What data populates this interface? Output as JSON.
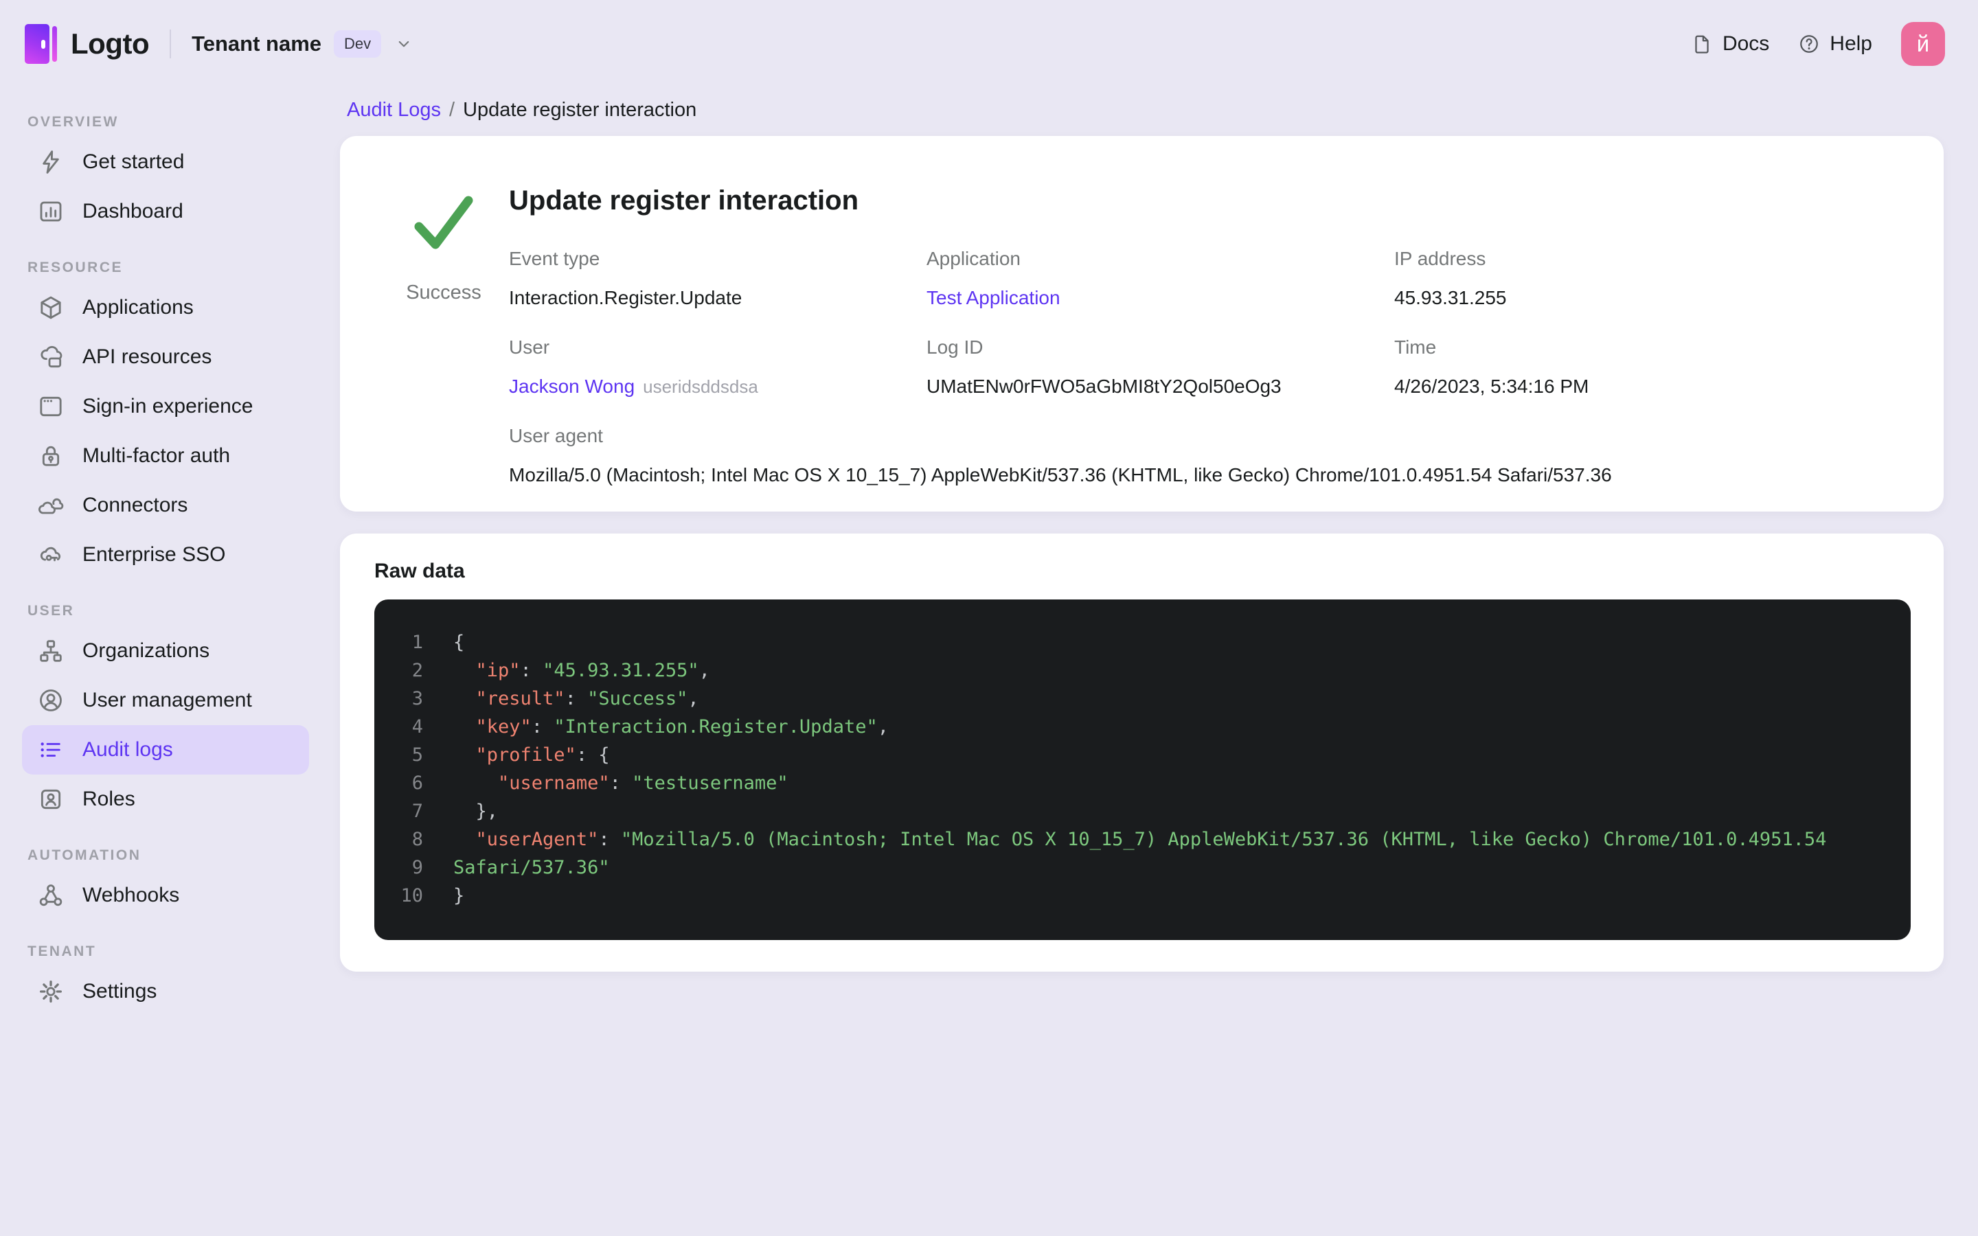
{
  "topbar": {
    "logo_text": "Logto",
    "tenant_name": "Tenant name",
    "tenant_badge": "Dev",
    "docs_label": "Docs",
    "help_label": "Help",
    "avatar_initial": "й"
  },
  "sidebar": {
    "sections": [
      {
        "label": "OVERVIEW",
        "items": [
          {
            "slug": "get-started",
            "label": "Get started",
            "icon": "lightning-icon",
            "active": false
          },
          {
            "slug": "dashboard",
            "label": "Dashboard",
            "icon": "dashboard-icon",
            "active": false
          }
        ]
      },
      {
        "label": "RESOURCE",
        "items": [
          {
            "slug": "applications",
            "label": "Applications",
            "icon": "cube-icon",
            "active": false
          },
          {
            "slug": "api-resources",
            "label": "API resources",
            "icon": "cloud-box-icon",
            "active": false
          },
          {
            "slug": "sign-in-experience",
            "label": "Sign-in experience",
            "icon": "browser-icon",
            "active": false
          },
          {
            "slug": "multi-factor-auth",
            "label": "Multi-factor auth",
            "icon": "lock-icon",
            "active": false
          },
          {
            "slug": "connectors",
            "label": "Connectors",
            "icon": "clouds-icon",
            "active": false
          },
          {
            "slug": "enterprise-sso",
            "label": "Enterprise SSO",
            "icon": "cloud-key-icon",
            "active": false
          }
        ]
      },
      {
        "label": "USER",
        "items": [
          {
            "slug": "organizations",
            "label": "Organizations",
            "icon": "org-chart-icon",
            "active": false
          },
          {
            "slug": "user-management",
            "label": "User management",
            "icon": "user-circle-icon",
            "active": false
          },
          {
            "slug": "audit-logs",
            "label": "Audit logs",
            "icon": "list-icon",
            "active": true
          },
          {
            "slug": "roles",
            "label": "Roles",
            "icon": "id-card-icon",
            "active": false
          }
        ]
      },
      {
        "label": "AUTOMATION",
        "items": [
          {
            "slug": "webhooks",
            "label": "Webhooks",
            "icon": "webhook-icon",
            "active": false
          }
        ]
      },
      {
        "label": "TENANT",
        "items": [
          {
            "slug": "settings",
            "label": "Settings",
            "icon": "gear-icon",
            "active": false
          }
        ]
      }
    ]
  },
  "breadcrumb": {
    "parent": "Audit Logs",
    "separator": "/",
    "current": "Update register interaction"
  },
  "event_card": {
    "status": "Success",
    "title": "Update register interaction",
    "fields": [
      {
        "slug": "event-type",
        "label": "Event type",
        "value": "Interaction.Register.Update",
        "type": "text"
      },
      {
        "slug": "application",
        "label": "Application",
        "value": "Test Application",
        "type": "link"
      },
      {
        "slug": "ip-address",
        "label": "IP address",
        "value": "45.93.31.255",
        "type": "text"
      },
      {
        "slug": "user",
        "label": "User",
        "value": "Jackson Wong",
        "suffix": "useridsddsdsa",
        "type": "link"
      },
      {
        "slug": "log-id",
        "label": "Log ID",
        "value": "UMatENw0rFWO5aGbMI8tY2Qol50eOg3",
        "type": "text"
      },
      {
        "slug": "time",
        "label": "Time",
        "value": "4/26/2023, 5:34:16 PM",
        "type": "text"
      }
    ],
    "user_agent": {
      "label": "User agent",
      "value": "Mozilla/5.0 (Macintosh; Intel Mac OS X 10_15_7) AppleWebKit/537.36 (KHTML, like Gecko) Chrome/101.0.4951.54 Safari/537.36"
    }
  },
  "raw_data_card": {
    "title": "Raw data",
    "code_lines": [
      {
        "number": "1",
        "tokens": [
          {
            "t": "{",
            "c": "punct"
          }
        ]
      },
      {
        "number": "2",
        "tokens": [
          {
            "t": "  ",
            "c": "punct"
          },
          {
            "t": "\"ip\"",
            "c": "key"
          },
          {
            "t": ": ",
            "c": "punct"
          },
          {
            "t": "\"45.93.31.255\"",
            "c": "string"
          },
          {
            "t": ",",
            "c": "punct"
          }
        ]
      },
      {
        "number": "3",
        "tokens": [
          {
            "t": "  ",
            "c": "punct"
          },
          {
            "t": "\"result\"",
            "c": "key"
          },
          {
            "t": ": ",
            "c": "punct"
          },
          {
            "t": "\"Success\"",
            "c": "string"
          },
          {
            "t": ",",
            "c": "punct"
          }
        ]
      },
      {
        "number": "4",
        "tokens": [
          {
            "t": "  ",
            "c": "punct"
          },
          {
            "t": "\"key\"",
            "c": "key"
          },
          {
            "t": ": ",
            "c": "punct"
          },
          {
            "t": "\"Interaction.Register.Update\"",
            "c": "string"
          },
          {
            "t": ",",
            "c": "punct"
          }
        ]
      },
      {
        "number": "5",
        "tokens": [
          {
            "t": "  ",
            "c": "punct"
          },
          {
            "t": "\"profile\"",
            "c": "key"
          },
          {
            "t": ": ",
            "c": "punct"
          },
          {
            "t": "{",
            "c": "punct"
          }
        ]
      },
      {
        "number": "6",
        "tokens": [
          {
            "t": "    ",
            "c": "punct"
          },
          {
            "t": "\"username\"",
            "c": "key"
          },
          {
            "t": ": ",
            "c": "punct"
          },
          {
            "t": "\"testusername\"",
            "c": "string"
          }
        ]
      },
      {
        "number": "7",
        "tokens": [
          {
            "t": "  },",
            "c": "punct"
          }
        ]
      },
      {
        "number": "8",
        "tokens": [
          {
            "t": "  ",
            "c": "punct"
          },
          {
            "t": "\"userAgent\"",
            "c": "key"
          },
          {
            "t": ": ",
            "c": "punct"
          },
          {
            "t": "\"Mozilla/5.0 (Macintosh; Intel Mac OS X 10_15_7) AppleWebKit/537.36 (KHTML, like Gecko) Chrome/101.0.4951.54",
            "c": "string"
          }
        ]
      },
      {
        "number": "9",
        "tokens": [
          {
            "t": "Safari/537.36\"",
            "c": "string"
          }
        ]
      },
      {
        "number": "10",
        "tokens": [
          {
            "t": "}",
            "c": "punct"
          }
        ]
      }
    ]
  },
  "colors": {
    "accent_purple": "#5d34f2",
    "success_green": "#4ca254",
    "avatar_pink": "#ec6c9b",
    "active_item_bg": "#ded5fa",
    "page_bg": "#e9e7f3",
    "code_bg": "#1a1c1e",
    "code_key": "#ef8371",
    "code_string": "#7dc87e"
  }
}
